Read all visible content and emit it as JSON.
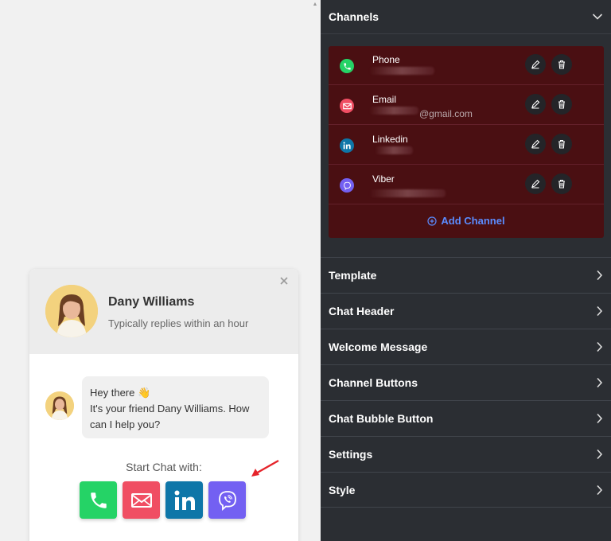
{
  "preview": {
    "agent_name": "Dany Williams",
    "agent_status": "Typically replies within an hour",
    "message_line1": "Hey there 👋",
    "message_line2": "It's your friend Dany Williams. How can I help you?",
    "start_label": "Start Chat with:",
    "buttons": [
      {
        "name": "phone",
        "color": "#25d366"
      },
      {
        "name": "email",
        "color": "#f04e63"
      },
      {
        "name": "linkedin",
        "color": "#0e76a8"
      },
      {
        "name": "viber",
        "color": "#7360f2"
      }
    ]
  },
  "panel": {
    "channels_title": "Channels",
    "channels": [
      {
        "label": "Phone",
        "value": "",
        "icon": "phone-icon",
        "color": "#25d366"
      },
      {
        "label": "Email",
        "value": "@gmail.com",
        "icon": "email-icon",
        "color": "#f04e63"
      },
      {
        "label": "Linkedin",
        "value": "",
        "icon": "linkedin-icon",
        "color": "#0e76a8"
      },
      {
        "label": "Viber",
        "value": "",
        "icon": "viber-icon",
        "color": "#7360f2"
      }
    ],
    "add_channel": "Add Channel",
    "sections": [
      "Template",
      "Chat Header",
      "Welcome Message",
      "Channel Buttons",
      "Chat Bubble Button",
      "Settings",
      "Style"
    ]
  },
  "colors": {
    "panel_bg": "#2b2e33",
    "channel_box": "#4a0f12",
    "accent_blue": "#5b8cff"
  }
}
